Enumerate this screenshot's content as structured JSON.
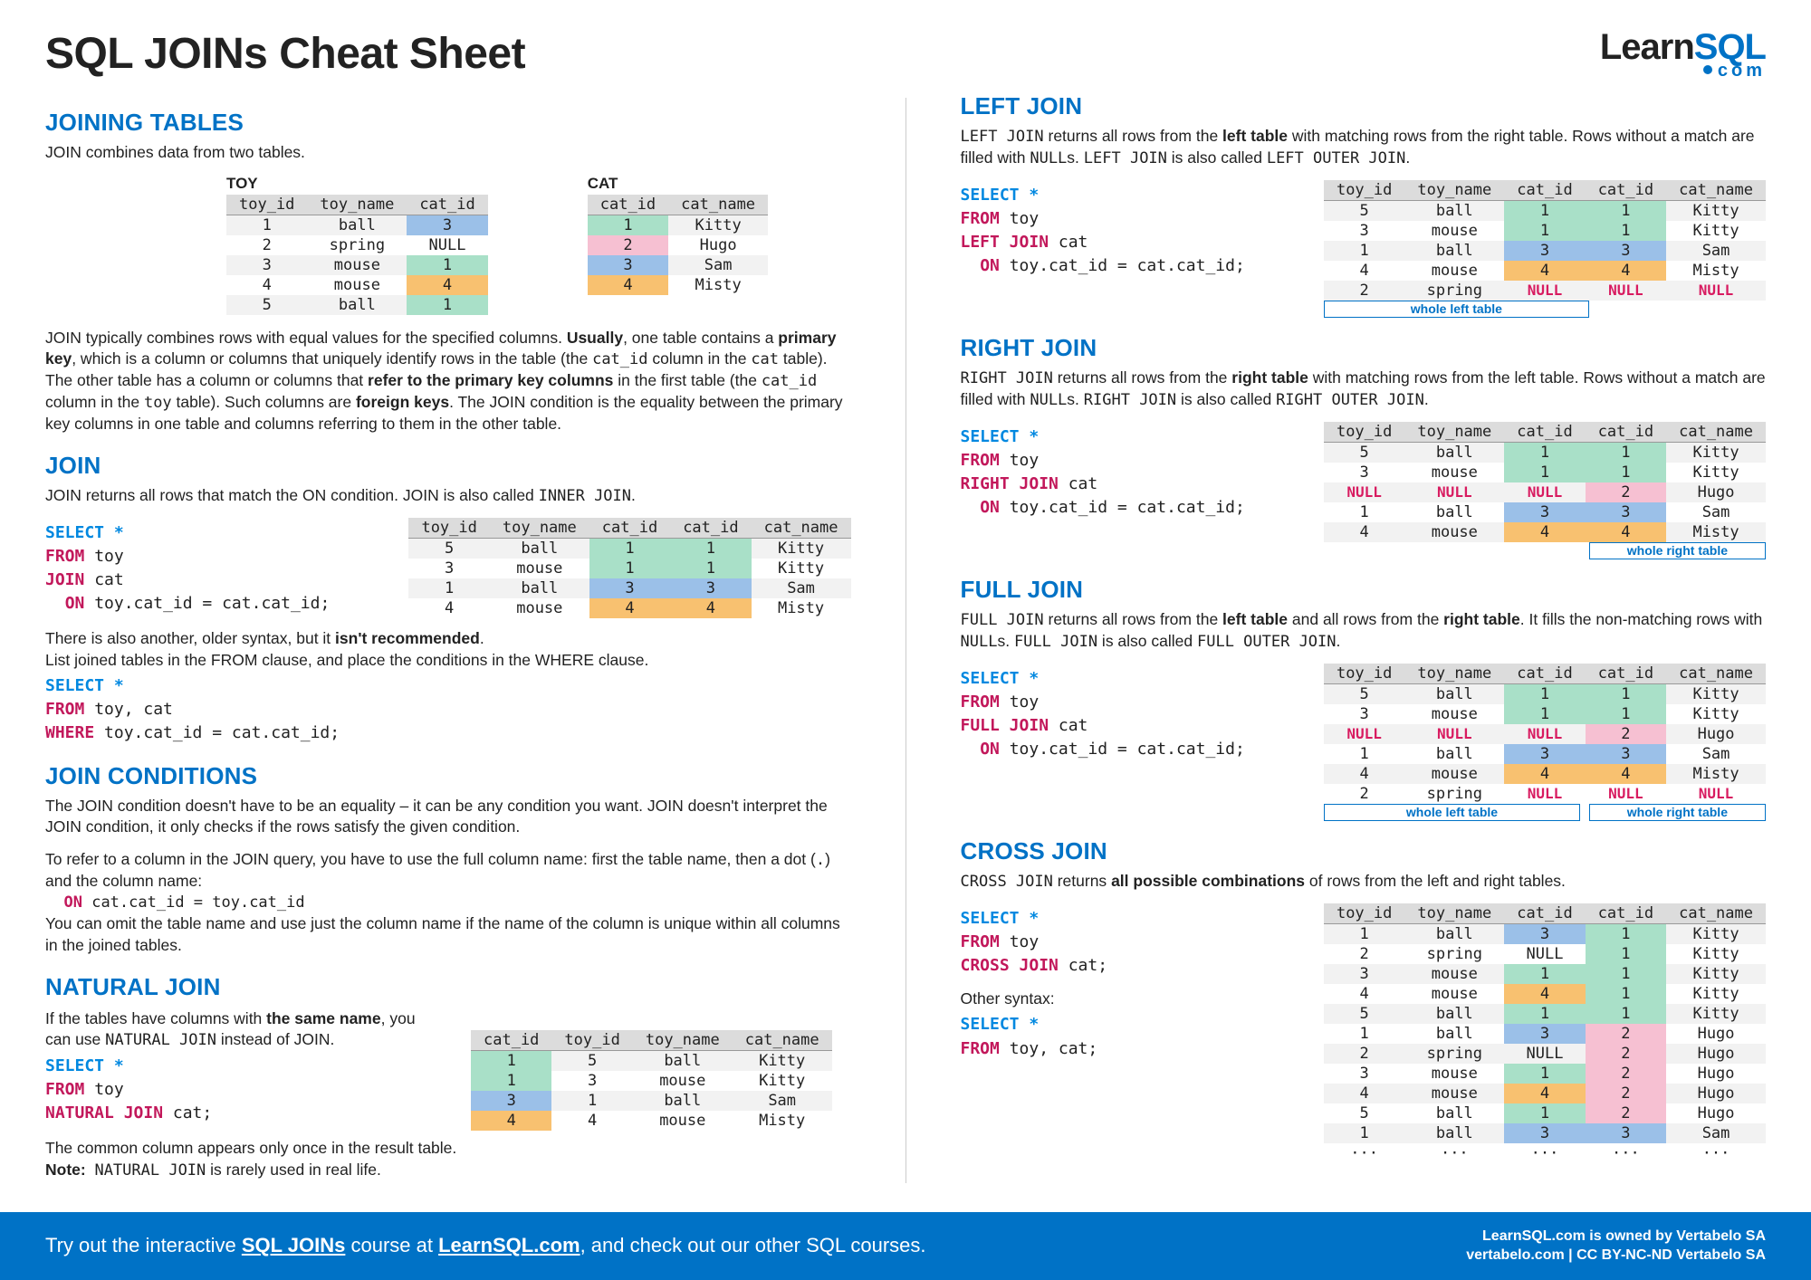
{
  "title": "SQL JOINs Cheat Sheet",
  "logo": {
    "main1": "Learn",
    "main2": "SQL",
    "sub": "com"
  },
  "joiningTables": {
    "heading": "JOINING TABLES",
    "intro": "JOIN combines data from two tables.",
    "toy_label": "TOY",
    "cat_label": "CAT",
    "toy_headers": [
      "toy_id",
      "toy_name",
      "cat_id"
    ],
    "toy_rows": [
      [
        "1",
        "ball",
        "3"
      ],
      [
        "2",
        "spring",
        "NULL"
      ],
      [
        "3",
        "mouse",
        "1"
      ],
      [
        "4",
        "mouse",
        "4"
      ],
      [
        "5",
        "ball",
        "1"
      ]
    ],
    "cat_headers": [
      "cat_id",
      "cat_name"
    ],
    "cat_rows": [
      [
        "1",
        "Kitty"
      ],
      [
        "2",
        "Hugo"
      ],
      [
        "3",
        "Sam"
      ],
      [
        "4",
        "Misty"
      ]
    ],
    "explain1": "JOIN typically combines rows with equal values for the specified columns. Usually, one table contains a primary key, which is a column or columns that uniquely identify rows in the table (the cat_id column in the cat table).",
    "explain2": "The other table has a column or columns that refer to the primary key columns in the first table (the cat_id column in the toy table). Such columns are foreign keys. The JOIN condition is the equality between the primary key columns in one table and columns referring to them in the other table."
  },
  "join": {
    "heading": "JOIN",
    "intro": "JOIN returns all rows that match the ON condition. JOIN is also called INNER JOIN.",
    "code": {
      "l1": "SELECT *",
      "l2": "FROM toy",
      "l3": "JOIN cat",
      "l4": "  ON toy.cat_id = cat.cat_id;"
    },
    "headers": [
      "toy_id",
      "toy_name",
      "cat_id",
      "cat_id",
      "cat_name"
    ],
    "rows": [
      [
        "5",
        "ball",
        "1",
        "1",
        "Kitty"
      ],
      [
        "3",
        "mouse",
        "1",
        "1",
        "Kitty"
      ],
      [
        "1",
        "ball",
        "3",
        "3",
        "Sam"
      ],
      [
        "4",
        "mouse",
        "4",
        "4",
        "Misty"
      ]
    ],
    "note1": "There is also another, older syntax, but it isn't recommended.",
    "note2": "List joined tables in the FROM clause, and place the conditions in the WHERE clause.",
    "code2": {
      "l1": "SELECT *",
      "l2": "FROM toy, cat",
      "l3": "WHERE toy.cat_id = cat.cat_id;"
    }
  },
  "joinConditions": {
    "heading": "JOIN CONDITIONS",
    "p1": "The JOIN condition doesn't have to be an equality – it can be any condition you want. JOIN doesn't interpret the JOIN condition, it only checks if the rows satisfy the given condition.",
    "p2a": "To refer to a column in the JOIN query, you have to use the full column name: first the table name, then a dot (",
    "p2b": ") and the column name:",
    "code": "  ON cat.cat_id = toy.cat_id",
    "p3": "You can omit the table name and use just the column name if the name of the column is unique within all columns in the joined tables."
  },
  "naturalJoin": {
    "heading": "NATURAL JOIN",
    "p1": "If the tables have columns with the same name, you can use NATURAL JOIN instead of JOIN.",
    "code": {
      "l1": "SELECT *",
      "l2": "FROM toy",
      "l3": "NATURAL JOIN cat;"
    },
    "headers": [
      "cat_id",
      "toy_id",
      "toy_name",
      "cat_name"
    ],
    "rows": [
      [
        "1",
        "5",
        "ball",
        "Kitty"
      ],
      [
        "1",
        "3",
        "mouse",
        "Kitty"
      ],
      [
        "3",
        "1",
        "ball",
        "Sam"
      ],
      [
        "4",
        "4",
        "mouse",
        "Misty"
      ]
    ],
    "p2": "The common column appears only once in the result table.",
    "p3": "Note:  NATURAL JOIN is rarely used in real life."
  },
  "leftJoin": {
    "heading": "LEFT JOIN",
    "intro": "LEFT JOIN returns all rows from the left table with matching rows from the right table. Rows without a match are filled with NULLs. LEFT JOIN is also called LEFT OUTER JOIN.",
    "code": {
      "l1": "SELECT *",
      "l2": "FROM toy",
      "l3": "LEFT JOIN cat",
      "l4": "  ON toy.cat_id = cat.cat_id;"
    },
    "headers": [
      "toy_id",
      "toy_name",
      "cat_id",
      "cat_id",
      "cat_name"
    ],
    "rows": [
      [
        "5",
        "ball",
        "1",
        "1",
        "Kitty"
      ],
      [
        "3",
        "mouse",
        "1",
        "1",
        "Kitty"
      ],
      [
        "1",
        "ball",
        "3",
        "3",
        "Sam"
      ],
      [
        "4",
        "mouse",
        "4",
        "4",
        "Misty"
      ],
      [
        "2",
        "spring",
        "NULL",
        "NULL",
        "NULL"
      ]
    ],
    "whole_left": "whole left table"
  },
  "rightJoin": {
    "heading": "RIGHT JOIN",
    "intro": "RIGHT JOIN returns all rows from the right table with matching rows from the left table. Rows without a match are filled with NULLs. RIGHT JOIN is also called RIGHT OUTER JOIN.",
    "code": {
      "l1": "SELECT *",
      "l2": "FROM toy",
      "l3": "RIGHT JOIN cat",
      "l4": "  ON toy.cat_id = cat.cat_id;"
    },
    "headers": [
      "toy_id",
      "toy_name",
      "cat_id",
      "cat_id",
      "cat_name"
    ],
    "rows": [
      [
        "5",
        "ball",
        "1",
        "1",
        "Kitty"
      ],
      [
        "3",
        "mouse",
        "1",
        "1",
        "Kitty"
      ],
      [
        "NULL",
        "NULL",
        "NULL",
        "2",
        "Hugo"
      ],
      [
        "1",
        "ball",
        "3",
        "3",
        "Sam"
      ],
      [
        "4",
        "mouse",
        "4",
        "4",
        "Misty"
      ]
    ],
    "whole_right": "whole right table"
  },
  "fullJoin": {
    "heading": "FULL JOIN",
    "intro": "FULL JOIN returns all rows from the left table and all rows from the right table. It fills the non-matching rows with NULLs. FULL JOIN is also called FULL OUTER JOIN.",
    "code": {
      "l1": "SELECT *",
      "l2": "FROM toy",
      "l3": "FULL JOIN cat",
      "l4": "  ON toy.cat_id = cat.cat_id;"
    },
    "headers": [
      "toy_id",
      "toy_name",
      "cat_id",
      "cat_id",
      "cat_name"
    ],
    "rows": [
      [
        "5",
        "ball",
        "1",
        "1",
        "Kitty"
      ],
      [
        "3",
        "mouse",
        "1",
        "1",
        "Kitty"
      ],
      [
        "NULL",
        "NULL",
        "NULL",
        "2",
        "Hugo"
      ],
      [
        "1",
        "ball",
        "3",
        "3",
        "Sam"
      ],
      [
        "4",
        "mouse",
        "4",
        "4",
        "Misty"
      ],
      [
        "2",
        "spring",
        "NULL",
        "NULL",
        "NULL"
      ]
    ],
    "whole_left": "whole left table",
    "whole_right": "whole right table"
  },
  "crossJoin": {
    "heading": "CROSS JOIN",
    "intro": "CROSS JOIN returns all possible combinations of rows from the left and right tables.",
    "code": {
      "l1": "SELECT *",
      "l2": "FROM toy",
      "l3": "CROSS JOIN cat;"
    },
    "other": "Other syntax:",
    "code2": {
      "l1": "SELECT *",
      "l2": "FROM toy, cat;"
    },
    "headers": [
      "toy_id",
      "toy_name",
      "cat_id",
      "cat_id",
      "cat_name"
    ],
    "rows": [
      [
        "1",
        "ball",
        "3",
        "1",
        "Kitty"
      ],
      [
        "2",
        "spring",
        "NULL",
        "1",
        "Kitty"
      ],
      [
        "3",
        "mouse",
        "1",
        "1",
        "Kitty"
      ],
      [
        "4",
        "mouse",
        "4",
        "1",
        "Kitty"
      ],
      [
        "5",
        "ball",
        "1",
        "1",
        "Kitty"
      ],
      [
        "1",
        "ball",
        "3",
        "2",
        "Hugo"
      ],
      [
        "2",
        "spring",
        "NULL",
        "2",
        "Hugo"
      ],
      [
        "3",
        "mouse",
        "1",
        "2",
        "Hugo"
      ],
      [
        "4",
        "mouse",
        "4",
        "2",
        "Hugo"
      ],
      [
        "5",
        "ball",
        "1",
        "2",
        "Hugo"
      ],
      [
        "1",
        "ball",
        "3",
        "3",
        "Sam"
      ],
      [
        "···",
        "···",
        "···",
        "···",
        "···"
      ]
    ]
  },
  "footer": {
    "left_a": "Try out the interactive ",
    "left_b": "SQL JOINs",
    "left_c": " course at ",
    "left_d": "LearnSQL.com",
    "left_e": ", and check out our other SQL courses.",
    "right1": "LearnSQL.com is owned by Vertabelo SA",
    "right2": "vertabelo.com | CC BY-NC-ND Vertabelo SA"
  }
}
